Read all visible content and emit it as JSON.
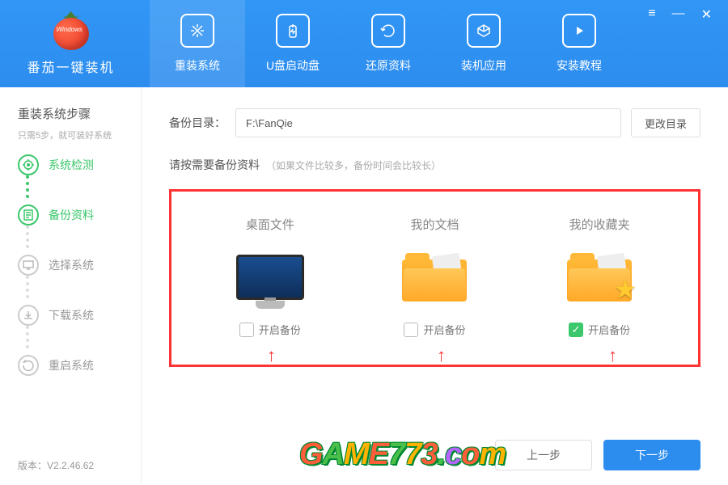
{
  "app": {
    "name": "番茄一键装机",
    "logo_badge": "Windows"
  },
  "nav": [
    {
      "label": "重装系统"
    },
    {
      "label": "U盘启动盘"
    },
    {
      "label": "还原资料"
    },
    {
      "label": "装机应用"
    },
    {
      "label": "安装教程"
    }
  ],
  "sidebar": {
    "title": "重装系统步骤",
    "subtitle": "只需5步，就可装好系统",
    "steps": [
      {
        "label": "系统检测"
      },
      {
        "label": "备份资料"
      },
      {
        "label": "选择系统"
      },
      {
        "label": "下载系统"
      },
      {
        "label": "重启系统"
      }
    ],
    "version": "版本：V2.2.46.62"
  },
  "main": {
    "dir_label": "备份目录：",
    "dir_value": "F:\\FanQie",
    "dir_btn": "更改目录",
    "hint": "请按需要备份资料",
    "hint_sub": "（如果文件比较多，备份时间会比较长）",
    "items": [
      {
        "title": "桌面文件",
        "check_label": "开启备份",
        "checked": false
      },
      {
        "title": "我的文档",
        "check_label": "开启备份",
        "checked": false
      },
      {
        "title": "我的收藏夹",
        "check_label": "开启备份",
        "checked": true
      }
    ],
    "prev_btn": "上一步",
    "next_btn": "下一步"
  },
  "watermark": "GAME773.com"
}
